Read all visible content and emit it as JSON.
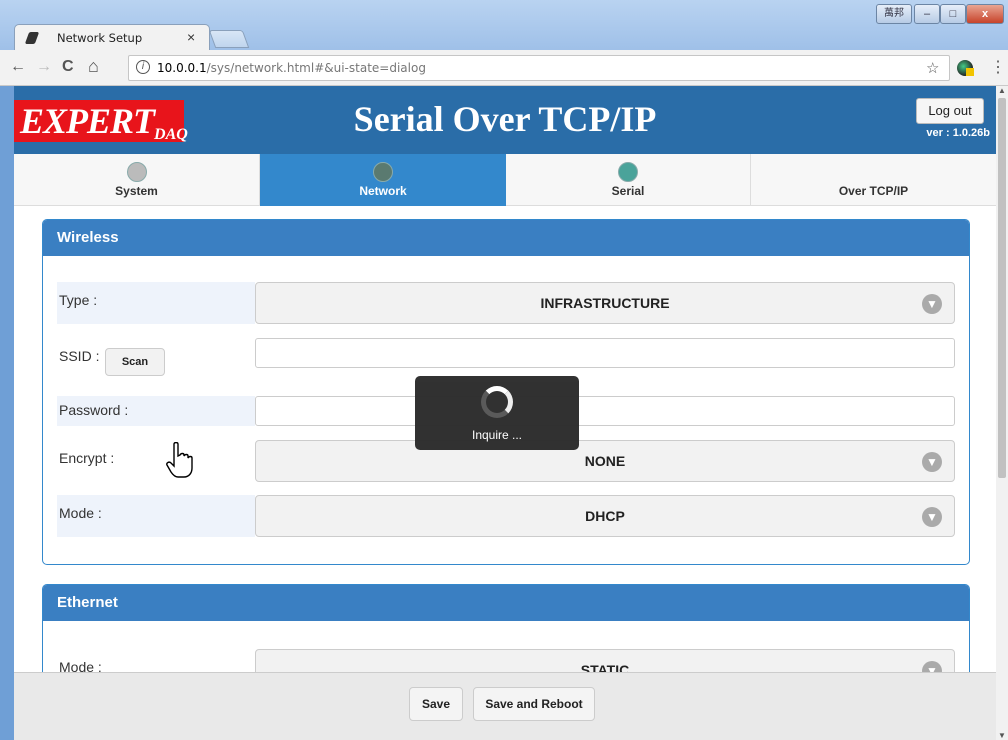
{
  "browser": {
    "tab_title": "Network Setup",
    "tab_close": "×",
    "url_host": "10.0.0.1",
    "url_path": "/sys/network.html#&ui-state=dialog",
    "ime_label": "萬邦",
    "min_glyph": "–",
    "max_glyph": "□",
    "close_glyph": "x",
    "back_glyph": "←",
    "forward_glyph": "→",
    "reload_glyph": "C",
    "home_glyph": "⌂",
    "star_glyph": "☆",
    "menu_glyph": "⋮",
    "info_glyph": "i"
  },
  "header": {
    "logo_main": "EXPERT",
    "logo_sub": "DAQ",
    "title": "Serial Over TCP/IP",
    "logout_label": "Log out",
    "version": "ver : 1.0.26b"
  },
  "nav": {
    "items": [
      {
        "label": "System",
        "icon": "gear-icon"
      },
      {
        "label": "Network",
        "icon": "network-icon",
        "active": true
      },
      {
        "label": "Serial",
        "icon": "serial-icon"
      },
      {
        "label": "Over TCP/IP",
        "icon": ""
      }
    ]
  },
  "wireless": {
    "title": "Wireless",
    "type_label": "Type :",
    "type_value": "INFRASTRUCTURE",
    "ssid_label": "SSID :",
    "scan_label": "Scan",
    "ssid_value": "",
    "password_label": "Password :",
    "password_value": "",
    "encrypt_label": "Encrypt :",
    "encrypt_value": "NONE",
    "mode_label": "Mode :",
    "mode_value": "DHCP"
  },
  "ethernet": {
    "title": "Ethernet",
    "mode_label": "Mode :",
    "mode_value": "STATIC"
  },
  "loader": {
    "text": "Inquire ..."
  },
  "footer": {
    "save_label": "Save",
    "save_reboot_label": "Save and Reboot"
  },
  "colors": {
    "header_bg": "#2a6da8",
    "accent": "#3388cc",
    "logo_red": "#e8141b"
  }
}
